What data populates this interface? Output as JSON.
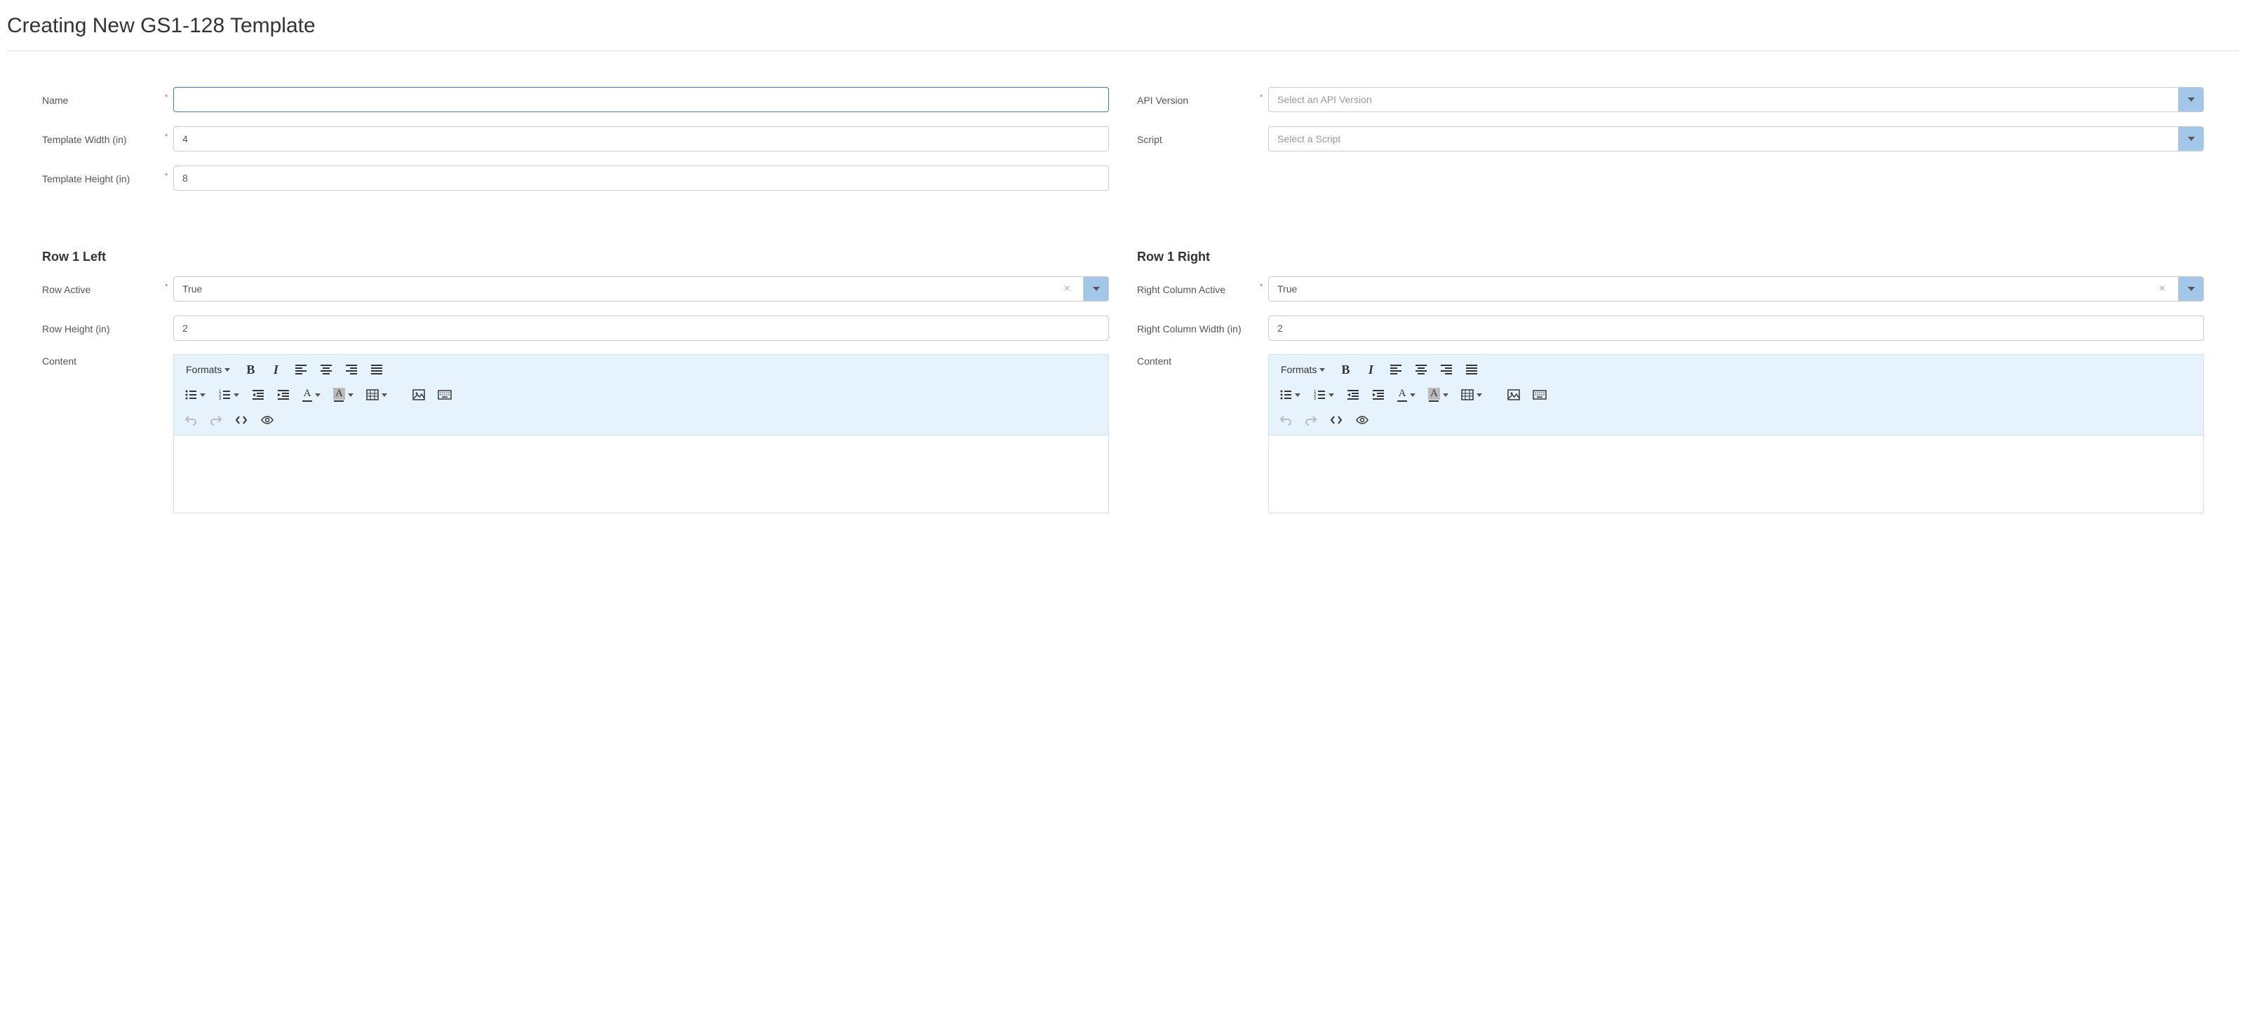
{
  "page": {
    "title": "Creating New GS1-128 Template"
  },
  "fields": {
    "name": {
      "label": "Name",
      "value": "",
      "required": true
    },
    "template_width": {
      "label": "Template Width (in)",
      "value": "4",
      "required": true
    },
    "template_height": {
      "label": "Template Height (in)",
      "value": "8",
      "required": true
    },
    "api_version": {
      "label": "API Version",
      "placeholder": "Select an API Version",
      "required": true
    },
    "script": {
      "label": "Script",
      "placeholder": "Select a Script",
      "required": false
    }
  },
  "row1_left": {
    "heading": "Row 1 Left",
    "row_active": {
      "label": "Row Active",
      "value": "True",
      "required": true
    },
    "row_height": {
      "label": "Row Height (in)",
      "value": "2"
    },
    "content": {
      "label": "Content"
    }
  },
  "row1_right": {
    "heading": "Row 1 Right",
    "right_col_active": {
      "label": "Right Column Active",
      "value": "True",
      "required": true
    },
    "right_col_width": {
      "label": "Right Column Width (in)",
      "value": "2"
    },
    "content": {
      "label": "Content"
    }
  },
  "editor": {
    "formats_label": "Formats"
  }
}
